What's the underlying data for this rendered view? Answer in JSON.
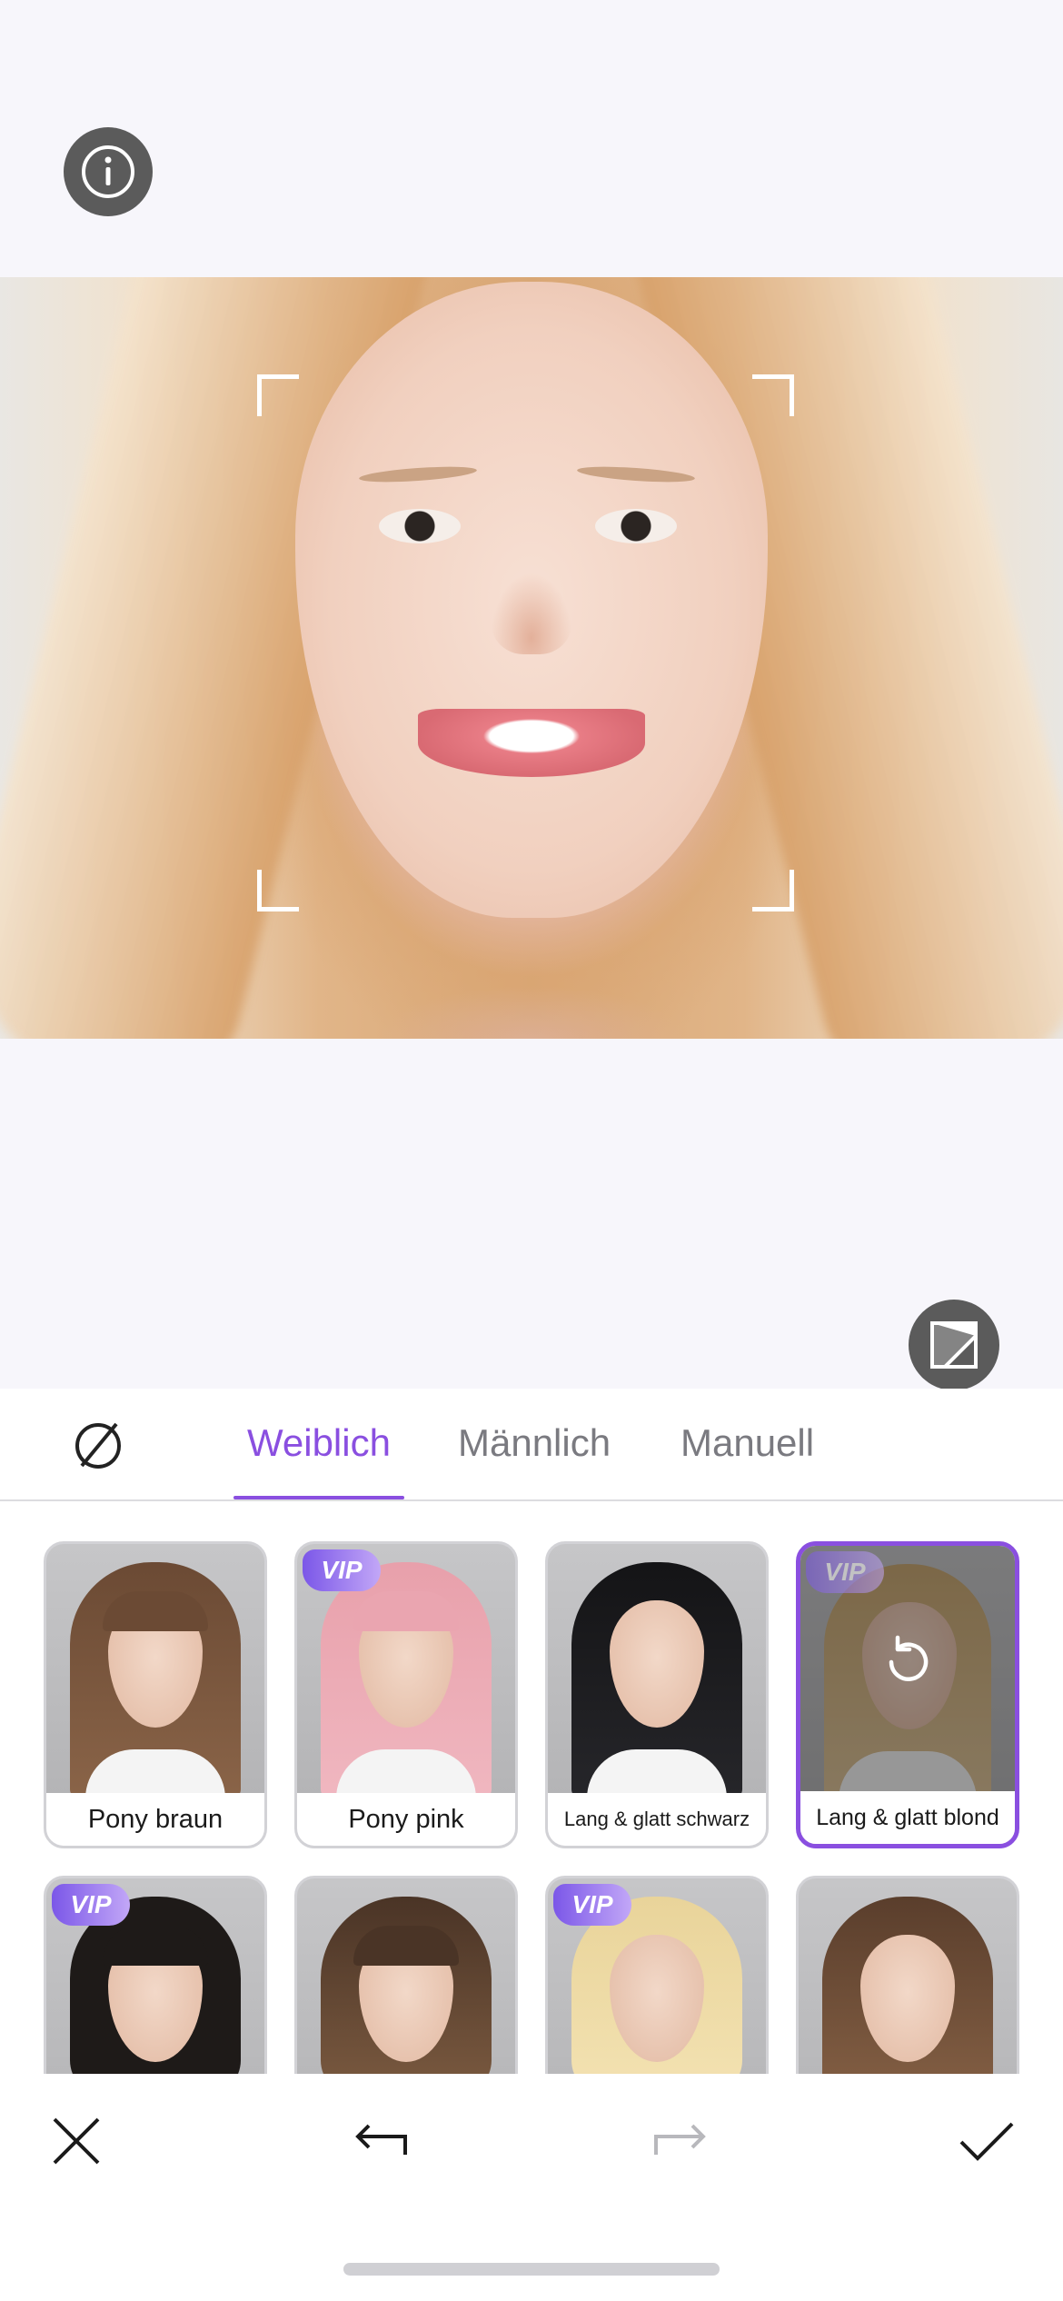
{
  "icons": {
    "info": "info-icon",
    "compare": "compare-icon",
    "none": "no-style-icon",
    "reset": "reset-icon",
    "close": "close-icon",
    "undo": "undo-icon",
    "redo": "redo-icon",
    "confirm": "checkmark-icon"
  },
  "colors": {
    "accent": "#8a4fe0",
    "tab_inactive": "#7a7a80"
  },
  "tabs": [
    {
      "label": "Weiblich",
      "active": true
    },
    {
      "label": "Männlich",
      "active": false
    },
    {
      "label": "Manuell",
      "active": false
    }
  ],
  "styles": [
    {
      "label": "Pony braun",
      "vip": false,
      "selected": false
    },
    {
      "label": "Pony pink",
      "vip": true,
      "selected": false
    },
    {
      "label": "Lang & glatt schwarz",
      "vip": false,
      "selected": false
    },
    {
      "label": "Lang & glatt blond",
      "vip": true,
      "selected": true
    },
    {
      "label": "",
      "vip": true,
      "selected": false
    },
    {
      "label": "",
      "vip": false,
      "selected": false
    },
    {
      "label": "",
      "vip": true,
      "selected": false
    },
    {
      "label": "",
      "vip": false,
      "selected": false
    }
  ],
  "vip_badge": "VIP",
  "toolbar": {
    "redo_enabled": false
  }
}
